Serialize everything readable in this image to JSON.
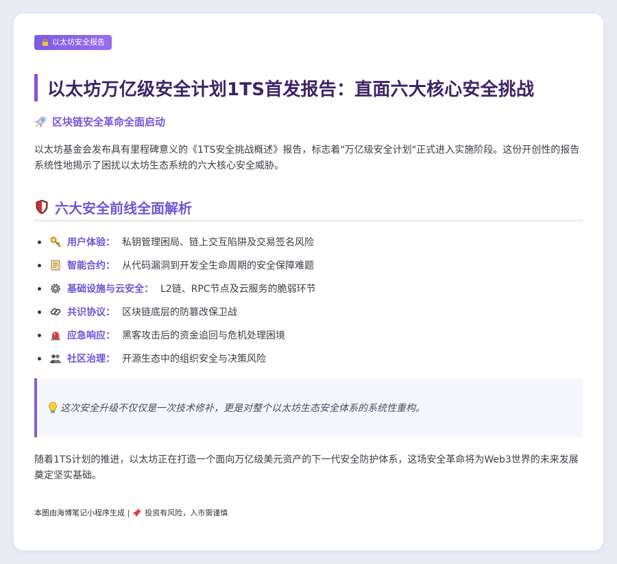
{
  "tag": {
    "icon": "lock-icon",
    "label": "以太坊安全报告"
  },
  "title": "以太坊万亿级安全计划1TS首发报告：直面六大核心安全挑战",
  "subheading": {
    "icon": "rocket-icon",
    "text": "区块链安全革命全面启动"
  },
  "intro": "以太坊基金会发布具有里程碑意义的《1TS安全挑战概述》报告，标志着\"万亿级安全计划\"正式进入实施阶段。这份开创性的报告系统性地揭示了困扰以太坊生态系统的六大核心安全威胁。",
  "section": {
    "icon": "shield-icon",
    "title": "六大安全前线全面解析"
  },
  "items": [
    {
      "icon": "key-icon",
      "label": "用户体验：",
      "desc": "私钥管理困局、链上交互陷阱及交易签名风险"
    },
    {
      "icon": "scroll-icon",
      "label": "智能合约：",
      "desc": "从代码漏洞到开发全生命周期的安全保障难题"
    },
    {
      "icon": "gear-icon",
      "label": "基础设施与云安全：",
      "desc": "L2链、RPC节点及云服务的脆弱环节"
    },
    {
      "icon": "link-icon",
      "label": "共识协议：",
      "desc": "区块链底层的防篡改保卫战"
    },
    {
      "icon": "siren-icon",
      "label": "应急响应：",
      "desc": "黑客攻击后的资金追回与危机处理困境"
    },
    {
      "icon": "people-icon",
      "label": "社区治理：",
      "desc": "开源生态中的组织安全与决策风险"
    }
  ],
  "quote": {
    "icon": "lightbulb-icon",
    "text": "这次安全升级不仅仅是一次技术修补，更是对整个以太坊生态安全体系的系统性重构。"
  },
  "closing": "随着1TS计划的推进，以太坊正在打造一个面向万亿级美元资产的下一代安全防护体系，这场安全革命将为Web3世界的未来发展奠定坚实基础。",
  "footer": {
    "source": "本图由海博笔记小程序生成 |",
    "icon": "pushpin-icon",
    "disclaimer": "投资有风险，入市需谨慎"
  },
  "colors": {
    "accent": "#7557d6",
    "title": "#3b2466",
    "tag_bg": "#7b5ce6"
  }
}
